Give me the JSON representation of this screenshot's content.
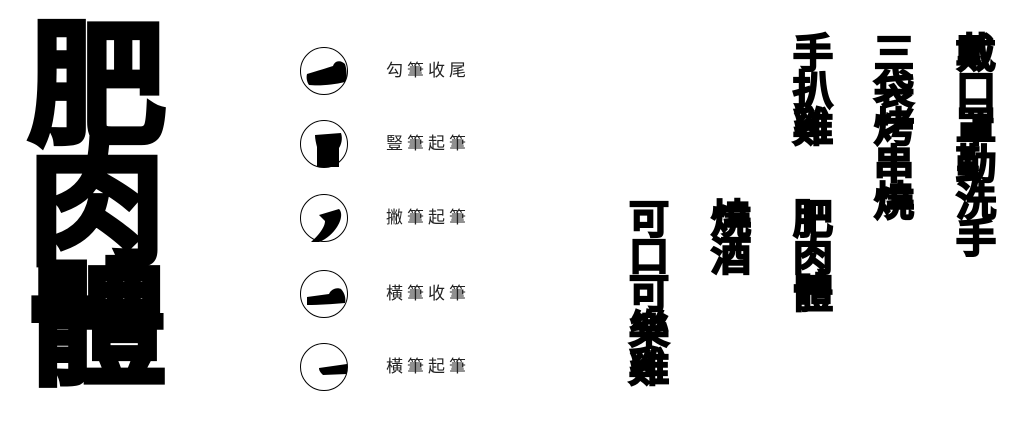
{
  "title_chars": [
    "肥",
    "肉",
    "體"
  ],
  "legend": [
    {
      "label": "勾筆收尾",
      "icon": "hook-stroke-end-icon"
    },
    {
      "label": "豎筆起筆",
      "icon": "vertical-stroke-start-icon"
    },
    {
      "label": "撇筆起筆",
      "icon": "left-falling-stroke-start-icon"
    },
    {
      "label": "橫筆收筆",
      "icon": "horizontal-stroke-end-icon"
    },
    {
      "label": "橫筆起筆",
      "icon": "horizontal-stroke-start-icon"
    }
  ],
  "phrases": [
    {
      "chars": [
        "戴",
        "口",
        "罩",
        "勤",
        "洗",
        "手"
      ]
    },
    {
      "chars": [
        "三",
        "袋",
        "烤",
        "串",
        "燒"
      ]
    },
    {
      "chars": [
        "手",
        "扒",
        "雞"
      ]
    },
    {
      "chars": [
        "肥",
        "肉",
        "體"
      ]
    },
    {
      "chars": [
        "燒",
        "酒"
      ]
    },
    {
      "chars": [
        "可",
        "口",
        "可",
        "樂",
        "雞"
      ]
    }
  ],
  "colors": {
    "ink": "#000000",
    "background": "#ffffff",
    "label": "#222222"
  }
}
